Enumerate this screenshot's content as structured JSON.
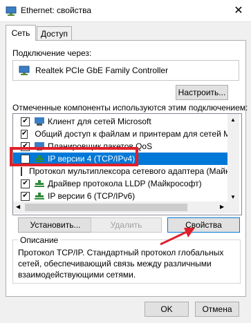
{
  "window": {
    "title": "Ethernet: свойства"
  },
  "tabs": [
    {
      "label": "Сеть"
    },
    {
      "label": "Доступ"
    }
  ],
  "connect_using": {
    "label": "Подключение через:",
    "adapter": "Realtek PCIe GbE Family Controller",
    "configure_button": "Настроить..."
  },
  "components": {
    "label": "Отмеченные компоненты используются этим подключением:",
    "items": [
      {
        "label": "Клиент для сетей Microsoft",
        "checked": true
      },
      {
        "label": "Общий доступ к файлам и принтерам для сетей Mi",
        "checked": true
      },
      {
        "label": "Планировщик пакетов QoS",
        "checked": true
      },
      {
        "label": "IP версии 4 (TCP/IPv4)",
        "checked": true,
        "selected": true
      },
      {
        "label": "Протокол мультиплексора сетевого адаптера (Майк",
        "checked": false
      },
      {
        "label": "Драйвер протокола LLDP (Майкрософт)",
        "checked": true
      },
      {
        "label": "IP версии 6 (TCP/IPv6)",
        "checked": true
      }
    ]
  },
  "actions": {
    "install": "Установить...",
    "uninstall": "Удалить",
    "properties": "Свойства"
  },
  "description": {
    "title": "Описание",
    "text": "Протокол TCP/IP. Стандартный протокол глобальных сетей, обеспечивающий связь между различными взаимодействующими сетями."
  },
  "footer": {
    "ok": "OK",
    "cancel": "Отмена"
  },
  "colors": {
    "selection": "#0078d7",
    "annotation": "#e0202a"
  }
}
